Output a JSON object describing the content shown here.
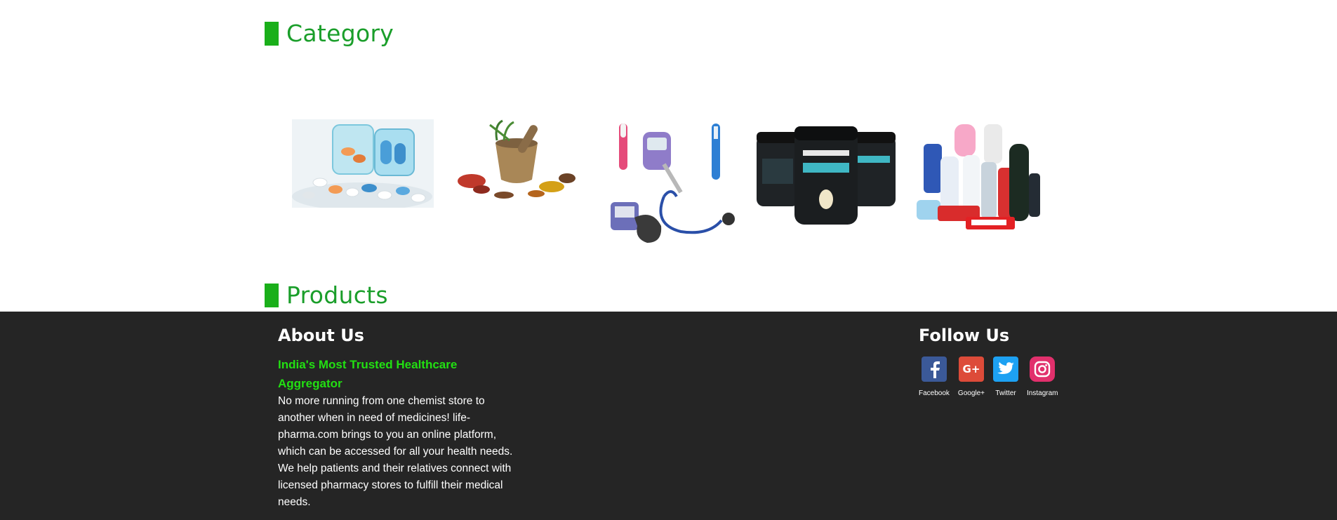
{
  "colors": {
    "accent_green": "#1a9e2a",
    "bar_green": "#1aaf1a",
    "tagline_green": "#22e012",
    "footer_bg": "#252525",
    "facebook": "#3b5998",
    "googleplus": "#dd4b39",
    "twitter": "#1da1f2",
    "instagram": "#e1306c"
  },
  "sections": {
    "category_title": "Category",
    "products_title": "Products"
  },
  "categories": [
    {
      "name": "medicines",
      "icon": "pills-image"
    },
    {
      "name": "ayurveda",
      "icon": "herbs-mortar-image"
    },
    {
      "name": "healthcare-devices",
      "icon": "medical-devices-image"
    },
    {
      "name": "nutrition",
      "icon": "protein-tubs-image"
    },
    {
      "name": "personal-care",
      "icon": "toiletries-image"
    }
  ],
  "footer": {
    "about_title": "About Us",
    "tagline": "India's Most Trusted Healthcare Aggregator",
    "description": "No more running from one chemist store to another when in need of medicines! life-pharma.com brings to you an online platform, which can be accessed for all your health needs. We help patients and their relatives connect with licensed pharmacy stores to fulfill their medical needs.",
    "follow_title": "Follow Us",
    "socials": [
      {
        "label": "Facebook",
        "icon": "facebook-icon"
      },
      {
        "label": "Google+",
        "icon": "google-plus-icon"
      },
      {
        "label": "Twitter",
        "icon": "twitter-icon"
      },
      {
        "label": "Instagram",
        "icon": "instagram-icon"
      }
    ]
  }
}
